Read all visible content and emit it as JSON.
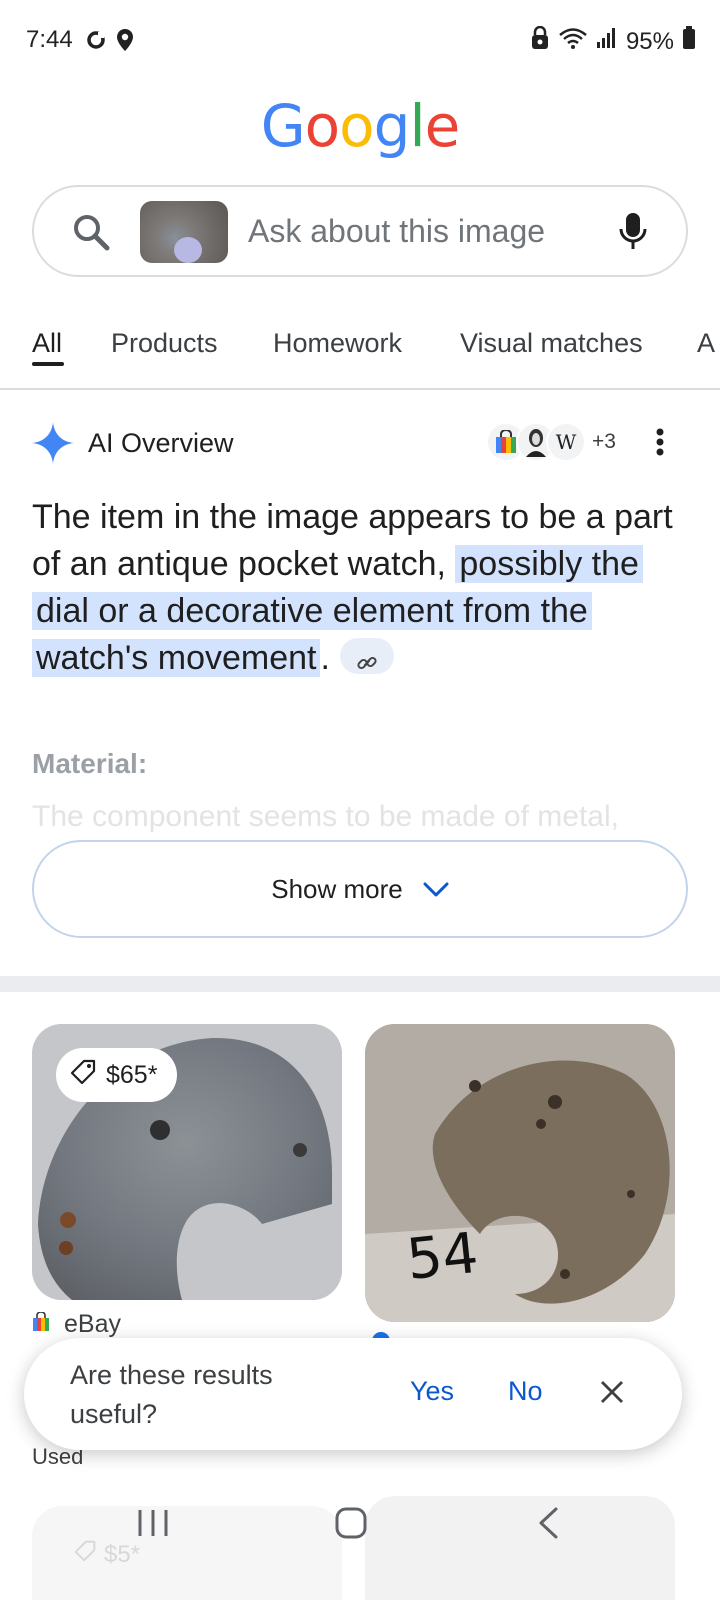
{
  "status_bar": {
    "time": "7:44",
    "battery": "95%"
  },
  "logo": {
    "letters": [
      "G",
      "o",
      "o",
      "g",
      "l",
      "e"
    ],
    "colors": [
      "#4285F4",
      "#EA4335",
      "#FBBC05",
      "#4285F4",
      "#34A853",
      "#EA4335"
    ]
  },
  "search": {
    "placeholder": "Ask about this image"
  },
  "tabs": {
    "items": [
      "All",
      "Products",
      "Homework",
      "Visual matches",
      "A"
    ],
    "active": "All"
  },
  "ai_overview": {
    "title": "AI Overview",
    "sources_more": "+3",
    "source_w_letter": "W",
    "text_plain": "The item in the image appears to be a part of an antique pocket watch, ",
    "text_highlight": "possibly the dial or a decorative element from the watch's movement",
    "text_end": ".",
    "sub_heading": "Material:",
    "sub_text": "The component seems to be made of metal,",
    "show_more_label": "Show more"
  },
  "results": {
    "card1_price": "$65*",
    "card1_source": "eBay",
    "card1_condition": "Used",
    "card3_price": "$5*"
  },
  "handwriting": "54",
  "feedback": {
    "question": "Are these results useful?",
    "yes": "Yes",
    "no": "No"
  },
  "colors": {
    "accent_blue": "#0b57d0",
    "highlight": "#d3e3fd"
  }
}
